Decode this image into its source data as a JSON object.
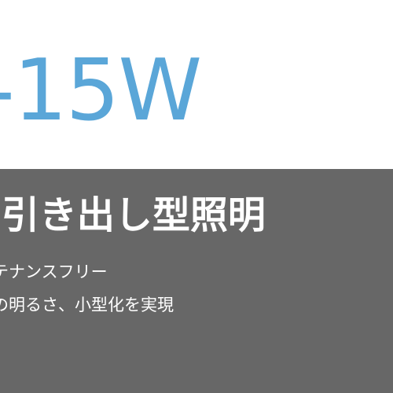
{
  "product": {
    "wattage": "-15W",
    "headline": "-引き出し型照明",
    "feature_1": "テナンスフリー",
    "feature_2": "の明るさ、小型化を実現"
  },
  "colors": {
    "accent_blue": "#5aa6d8",
    "panel_gray": "#676767",
    "background": "#ffffff"
  }
}
